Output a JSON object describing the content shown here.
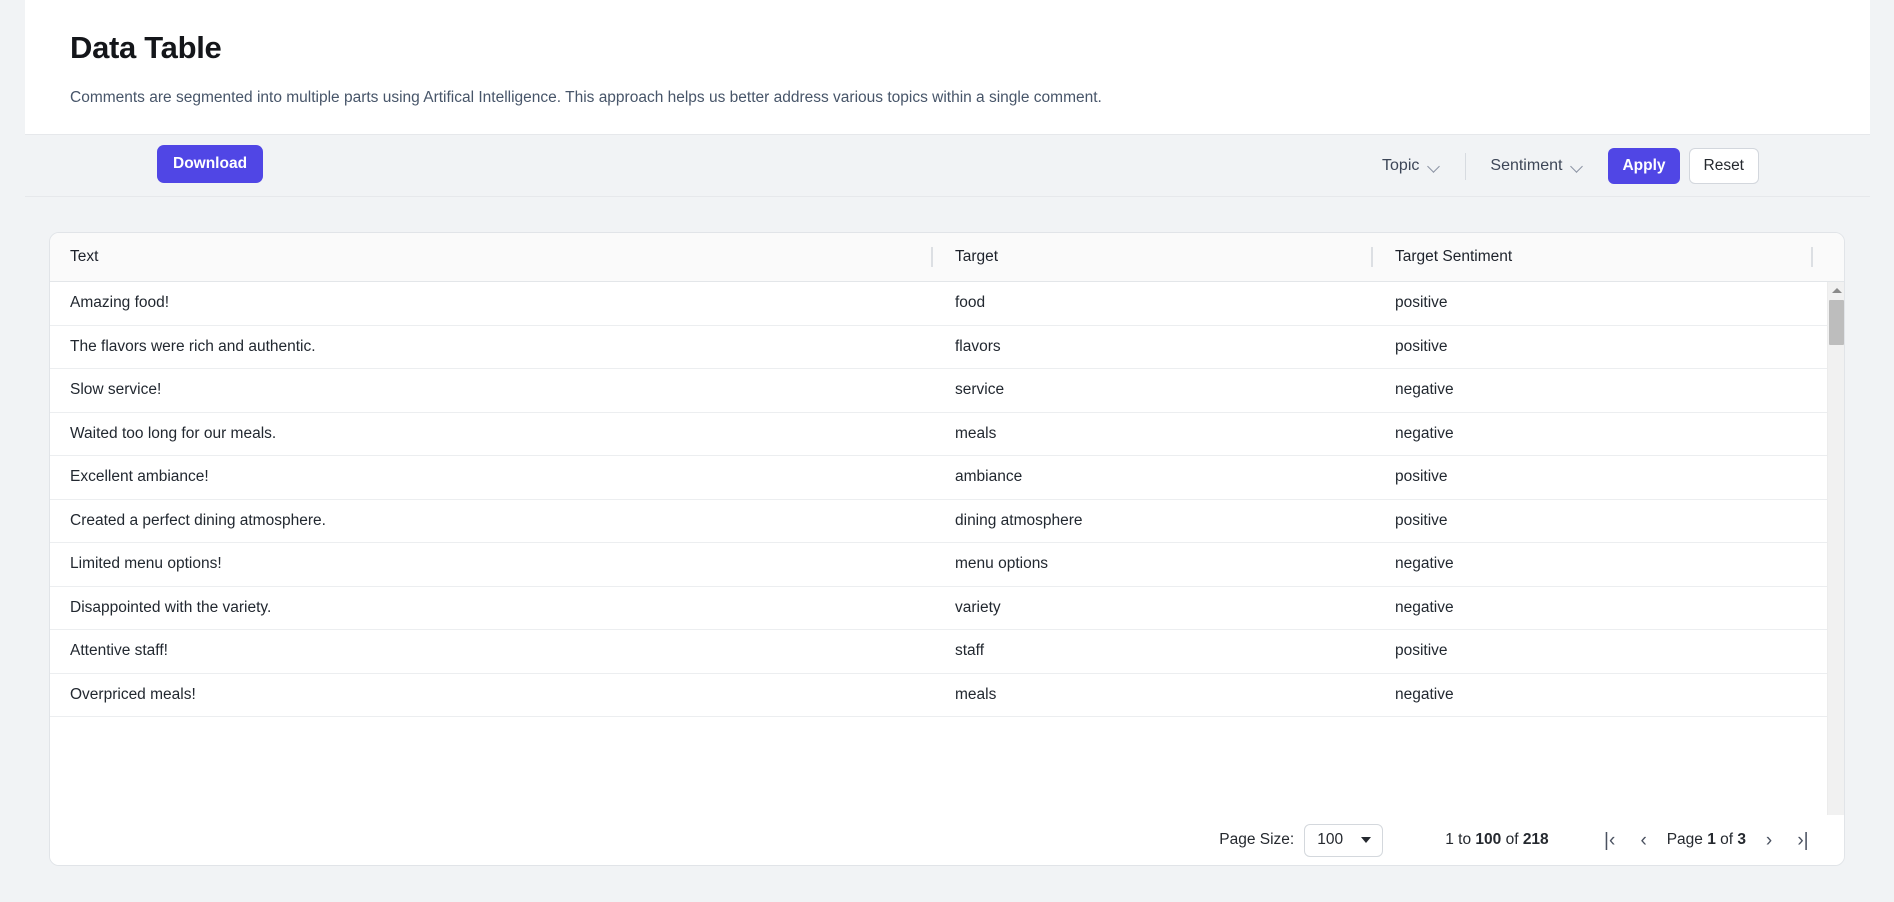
{
  "header": {
    "title": "Data Table",
    "subtitle": "Comments are segmented into multiple parts using Artifical Intelligence. This approach helps us better address various topics within a single comment."
  },
  "toolbar": {
    "download_label": "Download",
    "topic_label": "Topic",
    "sentiment_label": "Sentiment",
    "apply_label": "Apply",
    "reset_label": "Reset",
    "accent_color": "#5046e5"
  },
  "table": {
    "columns": [
      "Text",
      "Target",
      "Target Sentiment"
    ],
    "rows": [
      {
        "text": "Amazing food!",
        "target": "food",
        "sentiment": "positive"
      },
      {
        "text": "The flavors were rich and authentic.",
        "target": "flavors",
        "sentiment": "positive"
      },
      {
        "text": "Slow service!",
        "target": "service",
        "sentiment": "negative"
      },
      {
        "text": "Waited too long for our meals.",
        "target": "meals",
        "sentiment": "negative"
      },
      {
        "text": "Excellent ambiance!",
        "target": "ambiance",
        "sentiment": "positive"
      },
      {
        "text": "Created a perfect dining atmosphere.",
        "target": "dining atmosphere",
        "sentiment": "positive"
      },
      {
        "text": "Limited menu options!",
        "target": "menu options",
        "sentiment": "negative"
      },
      {
        "text": "Disappointed with the variety.",
        "target": "variety",
        "sentiment": "negative"
      },
      {
        "text": "Attentive staff!",
        "target": "staff",
        "sentiment": "positive"
      },
      {
        "text": "Overpriced meals!",
        "target": "meals",
        "sentiment": "negative"
      }
    ]
  },
  "pagination": {
    "page_size_label": "Page Size:",
    "page_size_value": "100",
    "range_prefix": "1 to ",
    "range_shown": "100",
    "range_mid": " of ",
    "range_total": "218",
    "page_word": "Page ",
    "current_page": "1",
    "page_of": " of ",
    "total_pages": "3",
    "first_icon": "|‹",
    "prev_icon": "‹",
    "next_icon": "›",
    "last_icon": "›|"
  }
}
